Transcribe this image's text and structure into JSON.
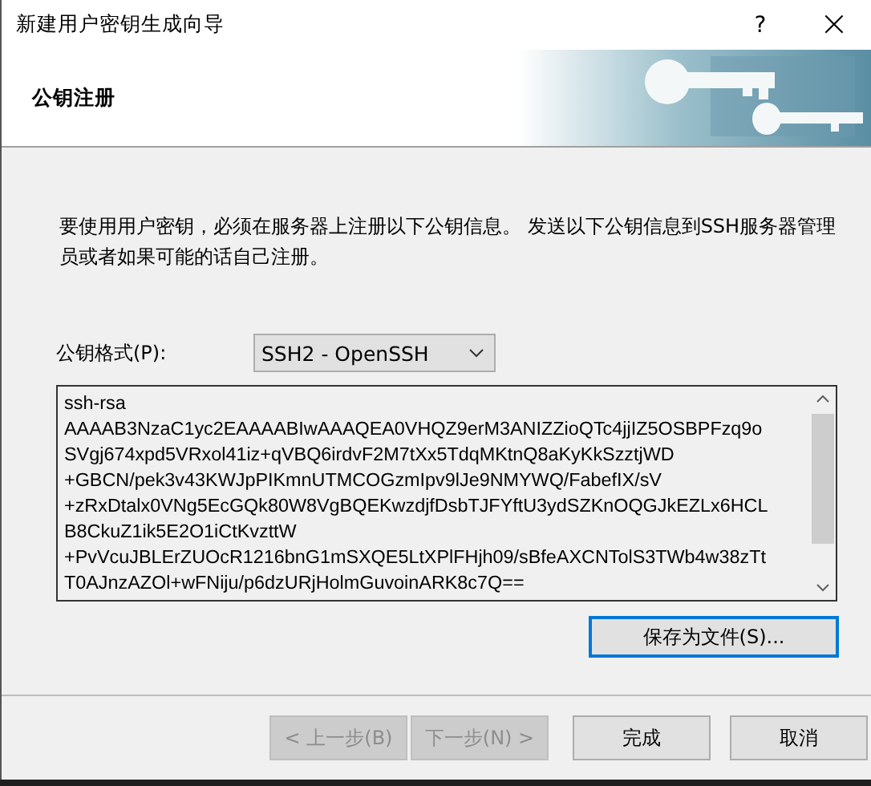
{
  "window": {
    "title": "新建用户密钥生成向导",
    "help": "?",
    "close": "×"
  },
  "header": {
    "title": "公钥注册"
  },
  "description": "要使用用户密钥，必须在服务器上注册以下公钥信息。 发送以下公钥信息到SSH服务器管理员或者如果可能的话自己注册。",
  "format": {
    "label": "公钥格式(P):",
    "value": "SSH2 - OpenSSH"
  },
  "public_key": {
    "lines": [
      "ssh-rsa",
      "AAAAB3NzaC1yc2EAAAABIwAAAQEA0VHQZ9erM3ANIZZioQTc4jjIZ5OSBPFzq9o",
      "SVgj674xpd5VRxol41iz+qVBQ6irdvF2M7tXx5TdqMKtnQ8aKyKkSzztjWD",
      "+GBCN/pek3v43KWJpPIKmnUTMCOGzmIpv9lJe9NMYWQ/FabefIX/sV",
      "+zRxDtalx0VNg5EcGQk80W8VgBQEKwzdjfDsbTJFYftU3ydSZKnOQGJkEZLx6HCL",
      "B8CkuZ1ik5E2O1iCtKvzttW",
      "+PvVcuJBLErZUOcR1216bnG1mSXQE5LtXPlFHjh09/sBfeAXCNTolS3TWb4w38zTt",
      "T0AJnzAZOl+wFNiju/p6dzURjHolmGuvoinARK8c7Q=="
    ]
  },
  "save_button": {
    "label": "保存为文件(S)...",
    "focused": true
  },
  "buttons": [
    {
      "label": "< 上一步(B)",
      "disabled": true
    },
    {
      "label": "下一步(N) >",
      "disabled": true
    },
    {
      "label": "完成",
      "disabled": false
    },
    {
      "label": "取消",
      "disabled": false
    }
  ]
}
